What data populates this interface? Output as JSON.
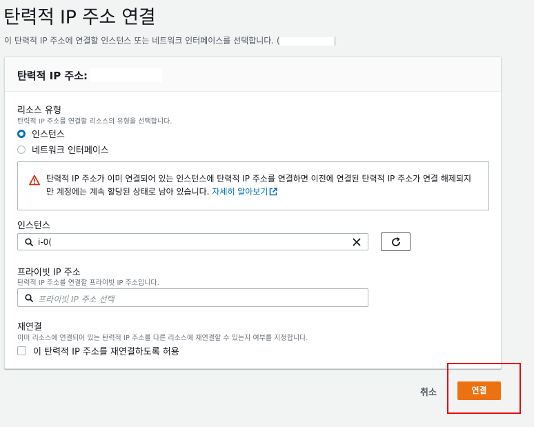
{
  "page": {
    "title": "탄력적 IP 주소 연결",
    "description": "이 탄력적 IP 주소에 연결할 인스턴스 또는 네트워크 인터페이스를 선택합니다. ("
  },
  "panel": {
    "title": "탄력적 IP 주소:"
  },
  "resource_type": {
    "label": "리소스 유형",
    "description": "탄력적 IP 주소를 연결할 리소스의 유형을 선택합니다.",
    "options": [
      {
        "label": "인스턴스",
        "checked": true
      },
      {
        "label": "네트워크 인터페이스",
        "checked": false
      }
    ]
  },
  "alert": {
    "text": "탄력적 IP 주소가 이미 연결되어 있는 인스턴스에 탄력적 IP 주소를 연결하면 이전에 연결된 탄력적 IP 주소가 연결 해제되지만 계정에는 계속 할당된 상태로 남아 있습니다.",
    "link": "자세히 알아보기",
    "icon": "warning-icon",
    "color": "#d13212"
  },
  "instance": {
    "label": "인스턴스",
    "value": "i-0(",
    "icons": [
      "search-icon",
      "clear-icon",
      "refresh-icon"
    ]
  },
  "private_ip": {
    "label": "프라이빗 IP 주소",
    "description": "탄력적 IP 주소를 연결할 프라이빗 IP 주소입니다.",
    "placeholder": "프라이빗 IP 주소 선택"
  },
  "reassociation": {
    "label": "재연결",
    "description": "이미 리소스에 연결되어 있는 탄력적 IP 주소를 다른 리소스에 재연결할 수 있는지 여부를 지정합니다.",
    "checkbox_label": "이 탄력적 IP 주소를 재연결하도록 허용",
    "checked": false
  },
  "actions": {
    "cancel": "취소",
    "submit": "연결",
    "submit_color": "#ec7211"
  }
}
